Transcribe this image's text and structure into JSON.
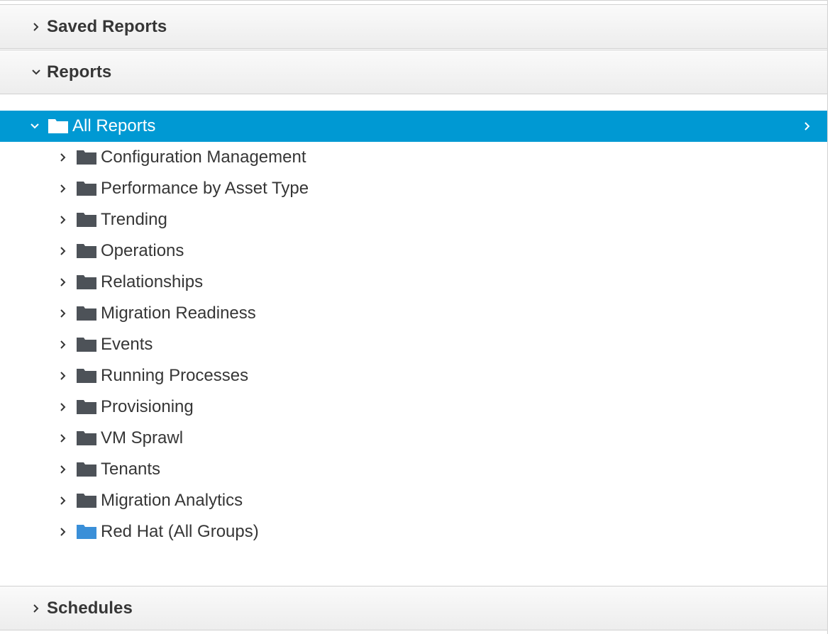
{
  "accordion": {
    "saved_reports": {
      "label": "Saved Reports",
      "expanded": false
    },
    "reports": {
      "label": "Reports",
      "expanded": true
    },
    "schedules": {
      "label": "Schedules",
      "expanded": false
    }
  },
  "tree": {
    "root": {
      "label": "All Reports",
      "expanded": true,
      "selected": true
    },
    "children": [
      {
        "label": "Configuration Management",
        "folder_color": "#4d5258"
      },
      {
        "label": "Performance by Asset Type",
        "folder_color": "#4d5258"
      },
      {
        "label": "Trending",
        "folder_color": "#4d5258"
      },
      {
        "label": "Operations",
        "folder_color": "#4d5258"
      },
      {
        "label": "Relationships",
        "folder_color": "#4d5258"
      },
      {
        "label": "Migration Readiness",
        "folder_color": "#4d5258"
      },
      {
        "label": "Events",
        "folder_color": "#4d5258"
      },
      {
        "label": "Running Processes",
        "folder_color": "#4d5258"
      },
      {
        "label": "Provisioning",
        "folder_color": "#4d5258"
      },
      {
        "label": "VM Sprawl",
        "folder_color": "#4d5258"
      },
      {
        "label": "Tenants",
        "folder_color": "#4d5258"
      },
      {
        "label": "Migration Analytics",
        "folder_color": "#4d5258"
      },
      {
        "label": "Red Hat (All Groups)",
        "folder_color": "#3a8fd8"
      }
    ]
  },
  "colors": {
    "selected_bg": "#0099d3",
    "folder_dark": "#4d5258",
    "folder_blue": "#3a8fd8"
  },
  "icons": {
    "collapsed": "chevron-right-icon",
    "expanded": "chevron-down-icon",
    "folder": "folder-icon"
  }
}
